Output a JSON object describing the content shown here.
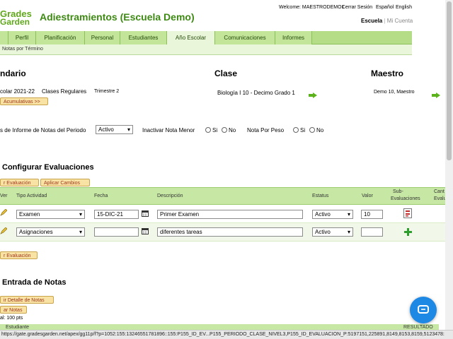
{
  "header": {
    "logo_top": "Grades",
    "logo_bottom": "Garden",
    "title": "Adiestramientos (Escuela Demo)",
    "welcome": "Welcome: MAESTRODEMO1",
    "logout": "Cerrar Sesión",
    "lang_es": "Español",
    "lang_en": "English",
    "school": "Escuela",
    "separator": "|",
    "my_account": "Mi Cuenta"
  },
  "tabs": [
    "Perfil",
    "Planificación",
    "Personal",
    "Estudiantes",
    "Año Escolar",
    "Comunicaciones",
    "Informes"
  ],
  "subnav": "Notas por Término",
  "summary": {
    "col1_head": "ndario",
    "col2_head": "Clase",
    "col3_head": "Maestro",
    "period": "colar 2021-22",
    "class_type": "Clases Regulares",
    "term": "Trimestre 2",
    "cumulative_btn": "Acumulativas >>",
    "class_name": "Biología I 10 -  Decimo Grado  1",
    "teacher": "Demo 10, Maestro"
  },
  "options": {
    "report_label": "s de Informe de Notas del Periodo",
    "report_value": "Activo",
    "inactivate_label": "Inactivar Nota Menor",
    "weight_label": "Nota Por Peso",
    "yes": "Si",
    "no": "No"
  },
  "config": {
    "title": "Configurar Evaluaciones",
    "add_btn": "r Evaluación",
    "apply_btn": "Aplicar Cambios",
    "add_btn_bottom": "r Evaluación"
  },
  "table": {
    "headers": {
      "ver": "Ver",
      "tipo": "Tipo Actividad",
      "fecha": "Fecha",
      "descripcion": "Descripción",
      "estatus": "Estatus",
      "valor": "Valor",
      "sub1": "Sub-",
      "sub2": "Evaluaciones",
      "cant1": "Cant",
      "cant2": "Evalua"
    },
    "rows": [
      {
        "tipo": "Examen",
        "fecha": "15-DIC-21",
        "descripcion": "Primer Examen",
        "estatus": "Activo",
        "valor": "10"
      },
      {
        "tipo": "Asignaciones",
        "fecha": "",
        "descripcion": "diferentes tareas",
        "estatus": "Activo",
        "valor": ""
      }
    ]
  },
  "grades": {
    "title": "Entrada de Notas",
    "detail_btn": "ir Detalle de Notas",
    "save_btn": "ar Notas",
    "total": "al: 100 pts",
    "col_student": "Estudiante",
    "col_result": "RESULTADO"
  },
  "status_url": "https://gate.gradesgarden.net/apex/gg11p/f?p=1052:155:13246551781896::155:P155_ID_EV...P155_PERIODO_CLASE_NIVEL3,P155_ID_EVALUACION_P:5197151,225891,8149,8153,8159,5123478:",
  "colors": {
    "brand": "#3d8a12",
    "tab_bg": "#b5dc86",
    "table_head": "#c7e8a5",
    "button_text": "#a0361c",
    "chat": "#1e88e5"
  }
}
